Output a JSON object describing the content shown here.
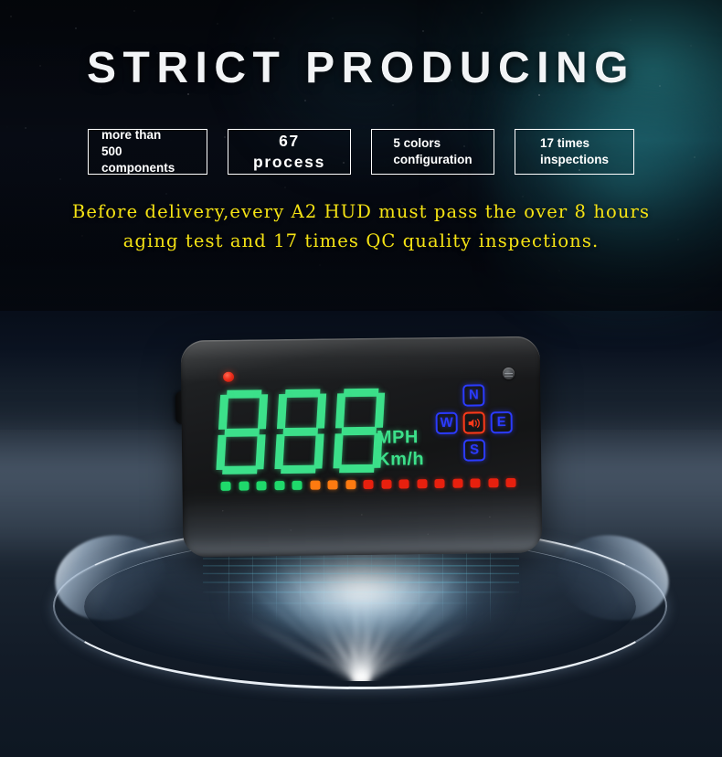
{
  "page": {
    "title": "STRICT PRODUCING"
  },
  "badges": [
    {
      "id": "more-than-500-components",
      "text": "more than\n500 components"
    },
    {
      "id": "67-process",
      "text": "67 process"
    },
    {
      "id": "5-colors-configuration",
      "text": "5 colors\nconfiguration"
    },
    {
      "id": "17-times-inspections",
      "text": "17 times\ninspections"
    }
  ],
  "subtitle": {
    "line1": "Before delivery,every A2 HUD must pass the over 8 hours",
    "line2": "aging test and 17 times QC quality inspections."
  },
  "device": {
    "name": "A2 HUD head-up display unit",
    "power_led": "red-led-indicator",
    "sensor": "light-sensor",
    "port": "cable-port",
    "display": {
      "digits": "888",
      "digit_color": "#3ce08a",
      "unit_primary": "MPH",
      "unit_secondary": "Km/h",
      "compass": {
        "north": "N",
        "west": "W",
        "east": "E",
        "south": "S",
        "center_icon": "speaker-icon",
        "letter_color": "#2b3bff",
        "center_color": "#ff3a1a"
      },
      "bar": {
        "total_segments": 17,
        "green_count": 5,
        "orange_count": 3,
        "red_count": 9,
        "green": "#1fd96b",
        "orange": "#ff7a10",
        "red": "#e8200e"
      }
    }
  },
  "scene": {
    "pedestal": "metallic-dish-pedestal",
    "projection": "cyan-holographic-grid",
    "accent_cyan": "#6ee0ff",
    "accent_yellow": "#f5e314",
    "accent_teal": "#2e969e"
  }
}
